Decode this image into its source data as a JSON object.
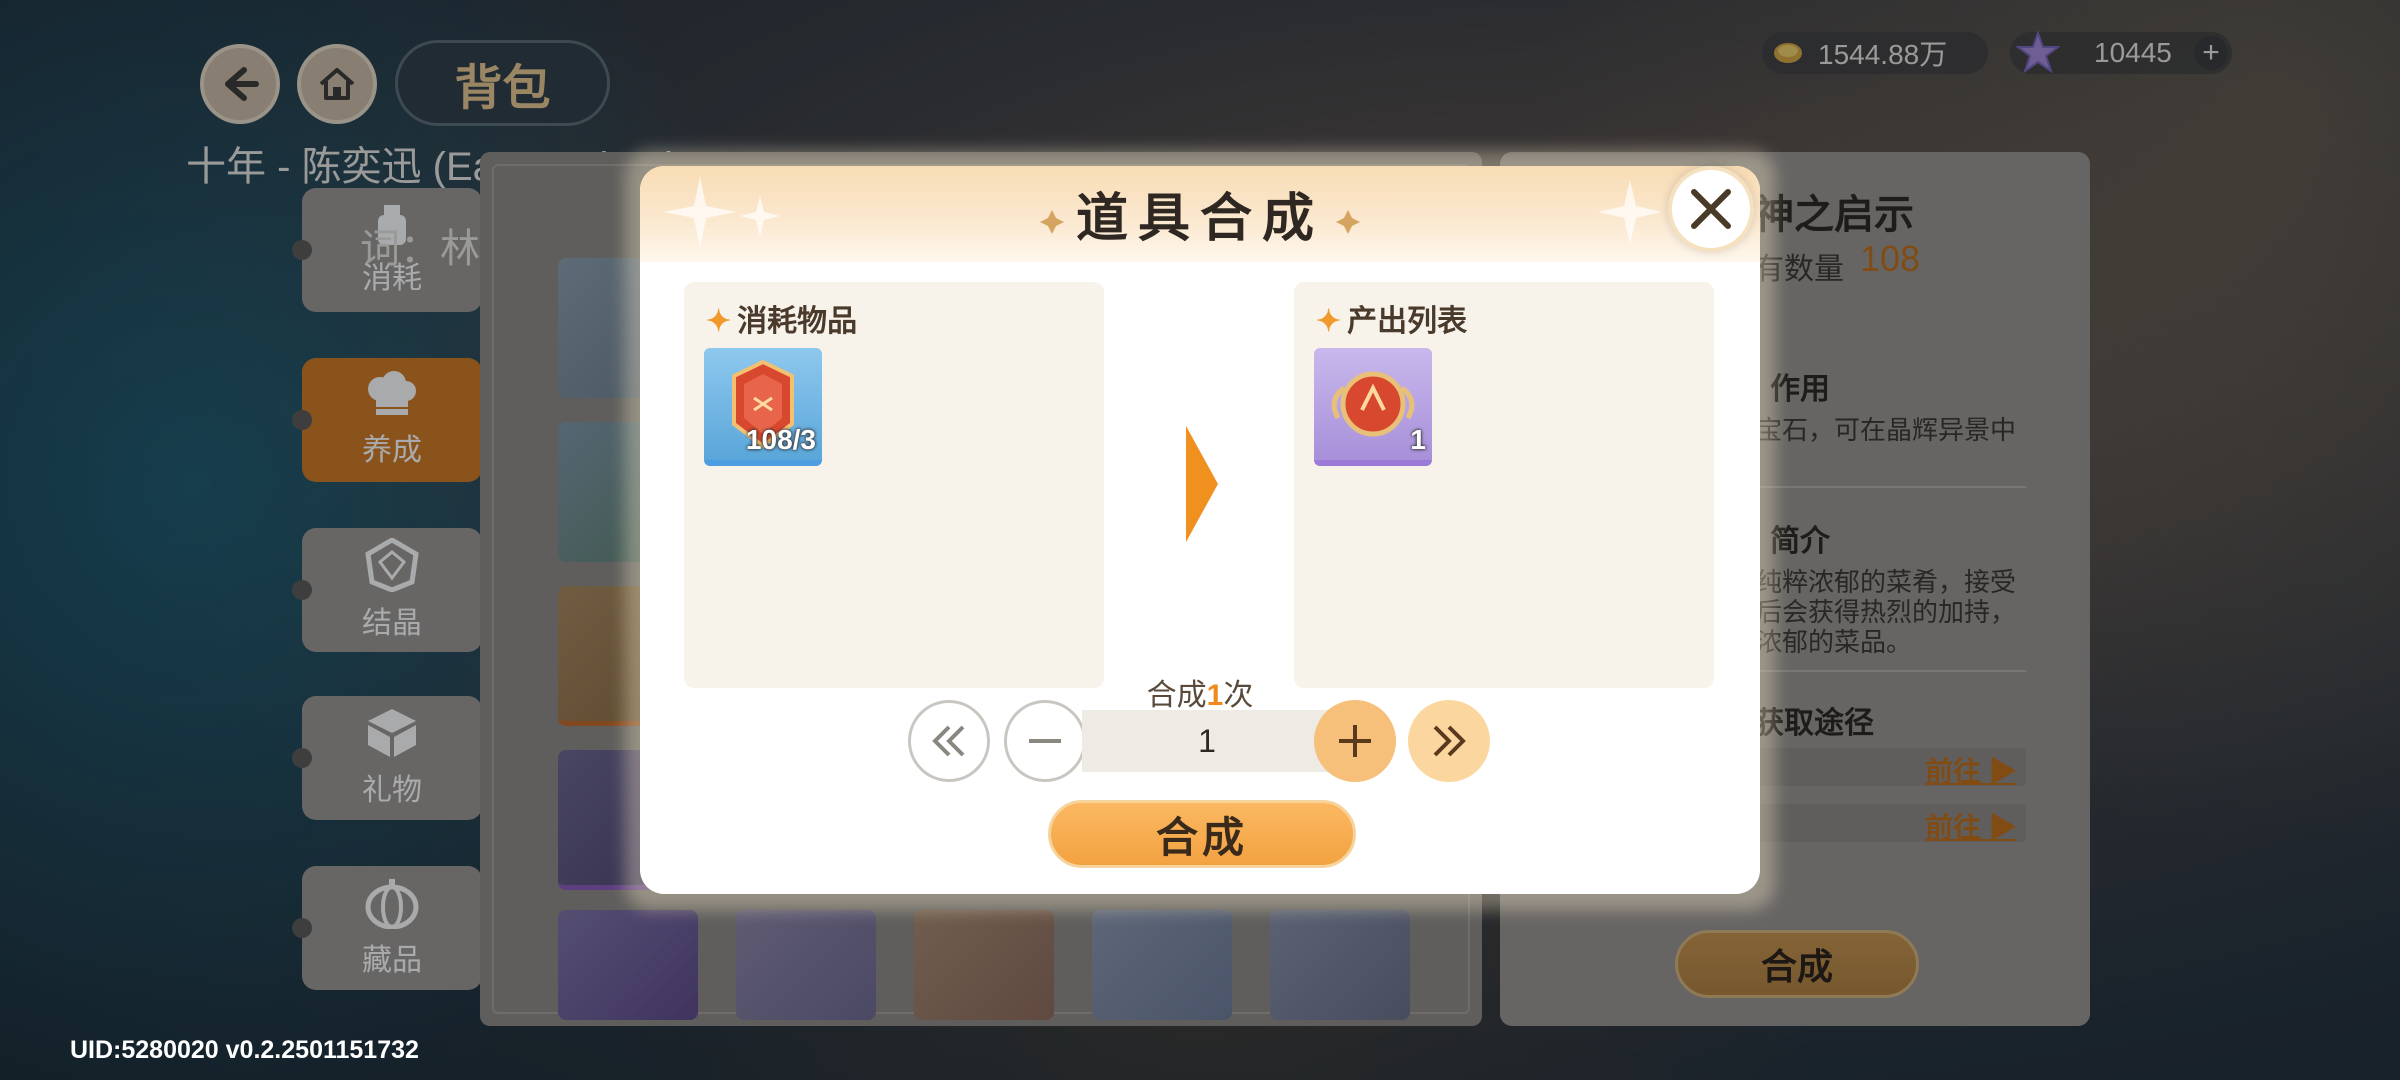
{
  "nav": {
    "title": "背包"
  },
  "lyrics": {
    "line1": "十年 - 陈奕迅 (Eason Chan)",
    "line2": "词：林夕"
  },
  "tabs": [
    {
      "label": "消耗",
      "icon": "potion-icon",
      "active": false
    },
    {
      "label": "养成",
      "icon": "chef-hat-icon",
      "active": true
    },
    {
      "label": "结晶",
      "icon": "crystal-icon",
      "active": false
    },
    {
      "label": "礼物",
      "icon": "gift-box-icon",
      "active": false
    },
    {
      "label": "藏品",
      "icon": "pumpkin-icon",
      "active": false
    }
  ],
  "currency": {
    "coins": "1544.88万",
    "gems": "10445",
    "add": "+"
  },
  "detail": {
    "name_partial": "神之启示",
    "qty_label_partial": "有数量",
    "qty_value": "108",
    "effect_heading_partial": "作用",
    "effect_text_partial": "宝石，可在晶辉异景中",
    "intro_heading_partial": "简介",
    "intro_line1": "纯粹浓郁的菜肴，接受",
    "intro_line2": "后会获得热烈的加持，",
    "intro_line3": "浓郁的菜品。",
    "source_heading_partial": "获取途径",
    "goto1": "前往 ▶",
    "goto2": "前往 ▶",
    "synth_button": "合成"
  },
  "dialog": {
    "title": "道具合成",
    "consume_label": "消耗物品",
    "output_label": "产出列表",
    "consume_item": {
      "count": "108/3",
      "color": "#6fb6e6"
    },
    "output_item": {
      "count": "1",
      "color": "#b49be0"
    },
    "times_prefix": "合成",
    "times_num": "1",
    "times_suffix": "次",
    "quantity": "1",
    "synth_button": "合成"
  },
  "uid": "UID:5280020  v0.2.2501151732"
}
